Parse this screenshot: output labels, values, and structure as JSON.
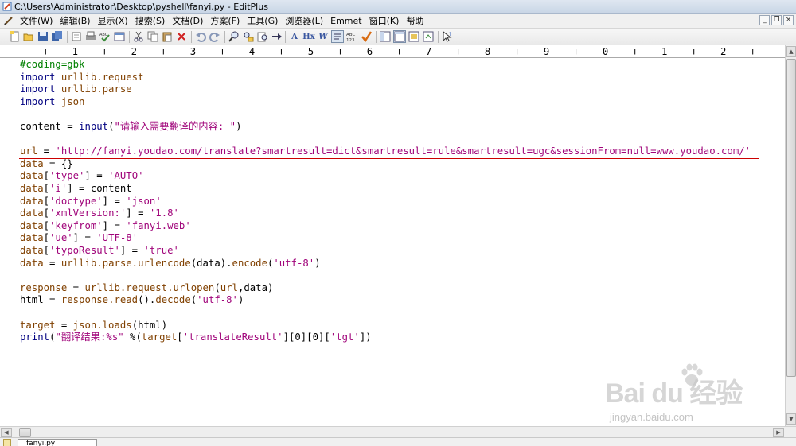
{
  "window": {
    "title": "C:\\Users\\Administrator\\Desktop\\pyshell\\fanyi.py - EditPlus"
  },
  "menu": {
    "items": [
      {
        "label": "文件(W)"
      },
      {
        "label": "编辑(B)"
      },
      {
        "label": "显示(X)"
      },
      {
        "label": "搜索(S)"
      },
      {
        "label": "文档(D)"
      },
      {
        "label": "方案(F)"
      },
      {
        "label": "工具(G)"
      },
      {
        "label": "浏览器(L)"
      },
      {
        "label": "Emmet"
      },
      {
        "label": "窗口(K)"
      },
      {
        "label": "帮助"
      }
    ]
  },
  "toolbar": {
    "icons": [
      "new-file-icon",
      "open-folder-icon",
      "save-icon",
      "save-all-icon",
      "print-preview-icon",
      "print-icon",
      "spell-check-icon",
      "check-mark-icon",
      "browser-icon",
      "cut-icon",
      "copy-icon",
      "paste-icon",
      "delete-icon",
      "undo-icon",
      "redo-icon",
      "find-icon",
      "replace-icon",
      "find-in-files-icon",
      "go-to-icon",
      "font-icon",
      "hex-icon",
      "word-wrap-icon",
      "wrap-lines-icon",
      "abc-icon",
      "spell-check-tick-icon",
      "layout-one-icon",
      "layout-two-icon",
      "layout-three-icon",
      "layout-four-icon",
      "help-cursor-icon"
    ],
    "font_label": "A",
    "hex_label": "Hx",
    "wrap_label": "W"
  },
  "ruler": {
    "text": "----+----1----+----2----+----3----+----4----+----5----+----6----+----7----+----8----+----9----+----0----+----1----+----2----+--"
  },
  "code": {
    "lines": [
      [
        {
          "t": "#coding=gbk",
          "c": "com"
        }
      ],
      [
        {
          "t": "import",
          "c": "kw"
        },
        {
          "t": " ",
          "c": "id"
        },
        {
          "t": "urllib.request",
          "c": "var"
        }
      ],
      [
        {
          "t": "import",
          "c": "kw"
        },
        {
          "t": " ",
          "c": "id"
        },
        {
          "t": "urllib.parse",
          "c": "var"
        }
      ],
      [
        {
          "t": "import",
          "c": "kw"
        },
        {
          "t": " ",
          "c": "id"
        },
        {
          "t": "json",
          "c": "var"
        }
      ],
      [],
      [
        {
          "t": "content = ",
          "c": "id"
        },
        {
          "t": "input",
          "c": "fn"
        },
        {
          "t": "(",
          "c": "id"
        },
        {
          "t": "\"请输入需要翻译的内容: \"",
          "c": "str"
        },
        {
          "t": ")",
          "c": "id"
        }
      ],
      [],
      [
        {
          "t": "url",
          "c": "var"
        },
        {
          "t": " = ",
          "c": "id"
        },
        {
          "t": "'http://fanyi.youdao.com/translate?smartresult=dict&smartresult=rule&smartresult=ugc&sessionFrom=null=www.youdao.com/'",
          "c": "str"
        }
      ],
      [
        {
          "t": "data",
          "c": "var"
        },
        {
          "t": " = {}",
          "c": "id"
        }
      ],
      [
        {
          "t": "data",
          "c": "var"
        },
        {
          "t": "[",
          "c": "id"
        },
        {
          "t": "'type'",
          "c": "str"
        },
        {
          "t": "] = ",
          "c": "id"
        },
        {
          "t": "'AUTO'",
          "c": "str"
        }
      ],
      [
        {
          "t": "data",
          "c": "var"
        },
        {
          "t": "[",
          "c": "id"
        },
        {
          "t": "'i'",
          "c": "str"
        },
        {
          "t": "] = content",
          "c": "id"
        }
      ],
      [
        {
          "t": "data",
          "c": "var"
        },
        {
          "t": "[",
          "c": "id"
        },
        {
          "t": "'doctype'",
          "c": "str"
        },
        {
          "t": "] = ",
          "c": "id"
        },
        {
          "t": "'json'",
          "c": "str"
        }
      ],
      [
        {
          "t": "data",
          "c": "var"
        },
        {
          "t": "[",
          "c": "id"
        },
        {
          "t": "'xmlVersion:'",
          "c": "str"
        },
        {
          "t": "] = ",
          "c": "id"
        },
        {
          "t": "'1.8'",
          "c": "str"
        }
      ],
      [
        {
          "t": "data",
          "c": "var"
        },
        {
          "t": "[",
          "c": "id"
        },
        {
          "t": "'keyfrom'",
          "c": "str"
        },
        {
          "t": "] = ",
          "c": "id"
        },
        {
          "t": "'fanyi.web'",
          "c": "str"
        }
      ],
      [
        {
          "t": "data",
          "c": "var"
        },
        {
          "t": "[",
          "c": "id"
        },
        {
          "t": "'ue'",
          "c": "str"
        },
        {
          "t": "] = ",
          "c": "id"
        },
        {
          "t": "'UTF-8'",
          "c": "str"
        }
      ],
      [
        {
          "t": "data",
          "c": "var"
        },
        {
          "t": "[",
          "c": "id"
        },
        {
          "t": "'typoResult'",
          "c": "str"
        },
        {
          "t": "] = ",
          "c": "id"
        },
        {
          "t": "'true'",
          "c": "str"
        }
      ],
      [
        {
          "t": "data",
          "c": "var"
        },
        {
          "t": " = ",
          "c": "id"
        },
        {
          "t": "urllib.parse.urlencode",
          "c": "var"
        },
        {
          "t": "(data).",
          "c": "id"
        },
        {
          "t": "encode",
          "c": "var"
        },
        {
          "t": "(",
          "c": "id"
        },
        {
          "t": "'utf-8'",
          "c": "str"
        },
        {
          "t": ")",
          "c": "id"
        }
      ],
      [],
      [
        {
          "t": "response",
          "c": "var"
        },
        {
          "t": " = ",
          "c": "id"
        },
        {
          "t": "urllib.request.urlopen",
          "c": "var"
        },
        {
          "t": "(",
          "c": "id"
        },
        {
          "t": "url",
          "c": "var"
        },
        {
          "t": ",data)",
          "c": "id"
        }
      ],
      [
        {
          "t": "html",
          "c": "id"
        },
        {
          "t": " = ",
          "c": "id"
        },
        {
          "t": "response.read",
          "c": "var"
        },
        {
          "t": "().",
          "c": "id"
        },
        {
          "t": "decode",
          "c": "var"
        },
        {
          "t": "(",
          "c": "id"
        },
        {
          "t": "'utf-8'",
          "c": "str"
        },
        {
          "t": ")",
          "c": "id"
        }
      ],
      [],
      [
        {
          "t": "target",
          "c": "var"
        },
        {
          "t": " = ",
          "c": "id"
        },
        {
          "t": "json.loads",
          "c": "var"
        },
        {
          "t": "(html)",
          "c": "id"
        }
      ],
      [
        {
          "t": "print",
          "c": "kw"
        },
        {
          "t": "(",
          "c": "id"
        },
        {
          "t": "\"翻译结果:%s\"",
          "c": "str"
        },
        {
          "t": " %(",
          "c": "id"
        },
        {
          "t": "target",
          "c": "var"
        },
        {
          "t": "[",
          "c": "id"
        },
        {
          "t": "'translateResult'",
          "c": "str"
        },
        {
          "t": "][0][0][",
          "c": "id"
        },
        {
          "t": "'tgt'",
          "c": "str"
        },
        {
          "t": "])",
          "c": "id"
        }
      ]
    ]
  },
  "tabs": [
    {
      "label": "fanyi.py"
    }
  ],
  "watermark": {
    "logo": "Bai du 经验",
    "url": "jingyan.baidu.com"
  },
  "colors": {
    "keyword": "#000080",
    "string": "#a0047a",
    "comment": "#008000",
    "identifier": "#804000",
    "cursor_line": "#cc0000"
  }
}
